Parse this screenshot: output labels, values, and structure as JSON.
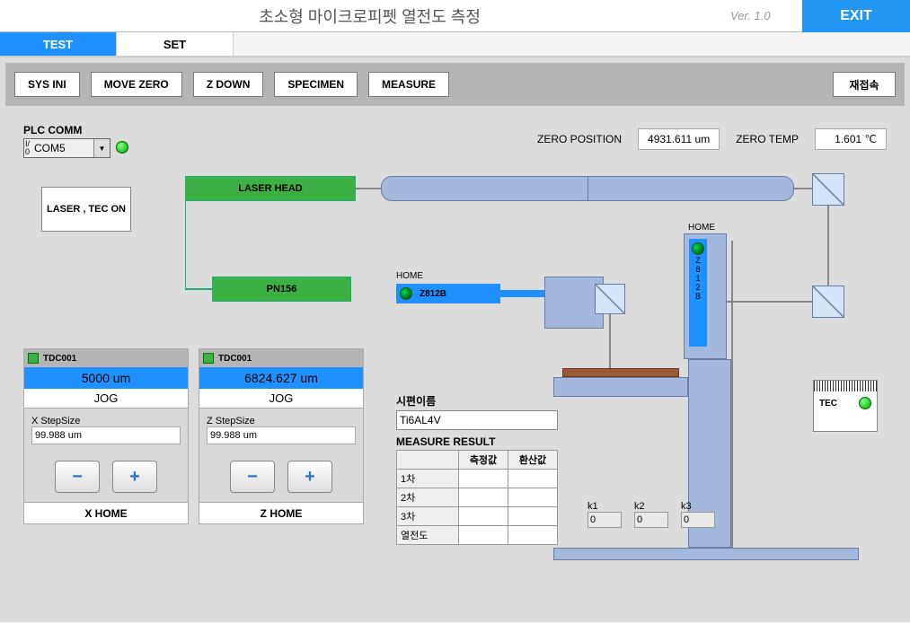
{
  "header": {
    "title": "초소형 마이크로피펫 열전도 측정",
    "version": "Ver. 1.0",
    "exit": "EXIT"
  },
  "tabs": {
    "test": "TEST",
    "set": "SET"
  },
  "commands": {
    "sys_ini": "SYS INI",
    "move_zero": "MOVE ZERO",
    "z_down": "Z DOWN",
    "specimen": "SPECIMEN",
    "measure": "MEASURE",
    "reconnect": "재접속"
  },
  "plc": {
    "label": "PLC COMM",
    "port": "COM5"
  },
  "zero": {
    "pos_label": "ZERO POSITION",
    "pos_value": "4931.611 um",
    "temp_label": "ZERO TEMP",
    "temp_value": "1.601 ℃"
  },
  "laser_tec": "LASER , TEC ON",
  "diagram": {
    "laser_head": "LASER HEAD",
    "pn": "PN156",
    "z_a": "Z812B",
    "z_b": "Z812B",
    "home": "HOME"
  },
  "ctrl_x": {
    "name": "TDC001",
    "pos": "5000 um",
    "jog": "JOG",
    "step_label": "X StepSize",
    "step_value": "99.988 um",
    "home": "X HOME"
  },
  "ctrl_z": {
    "name": "TDC001",
    "pos": "6824.627 um",
    "jog": "JOG",
    "step_label": "Z StepSize",
    "step_value": "99.988 um",
    "home": "Z HOME"
  },
  "specimen": {
    "name_label": "시편이름",
    "name_value": "Ti6AL4V",
    "result_label": "MEASURE RESULT",
    "cols": {
      "measured": "측정값",
      "converted": "환산값"
    },
    "rows": {
      "r1": "1차",
      "r2": "2차",
      "r3": "3차",
      "tc": "열전도"
    }
  },
  "k": {
    "k1": {
      "lbl": "k1",
      "val": "0"
    },
    "k2": {
      "lbl": "k2",
      "val": "0"
    },
    "k3": {
      "lbl": "k3",
      "val": "0"
    }
  },
  "tec": {
    "label": "TEC"
  }
}
